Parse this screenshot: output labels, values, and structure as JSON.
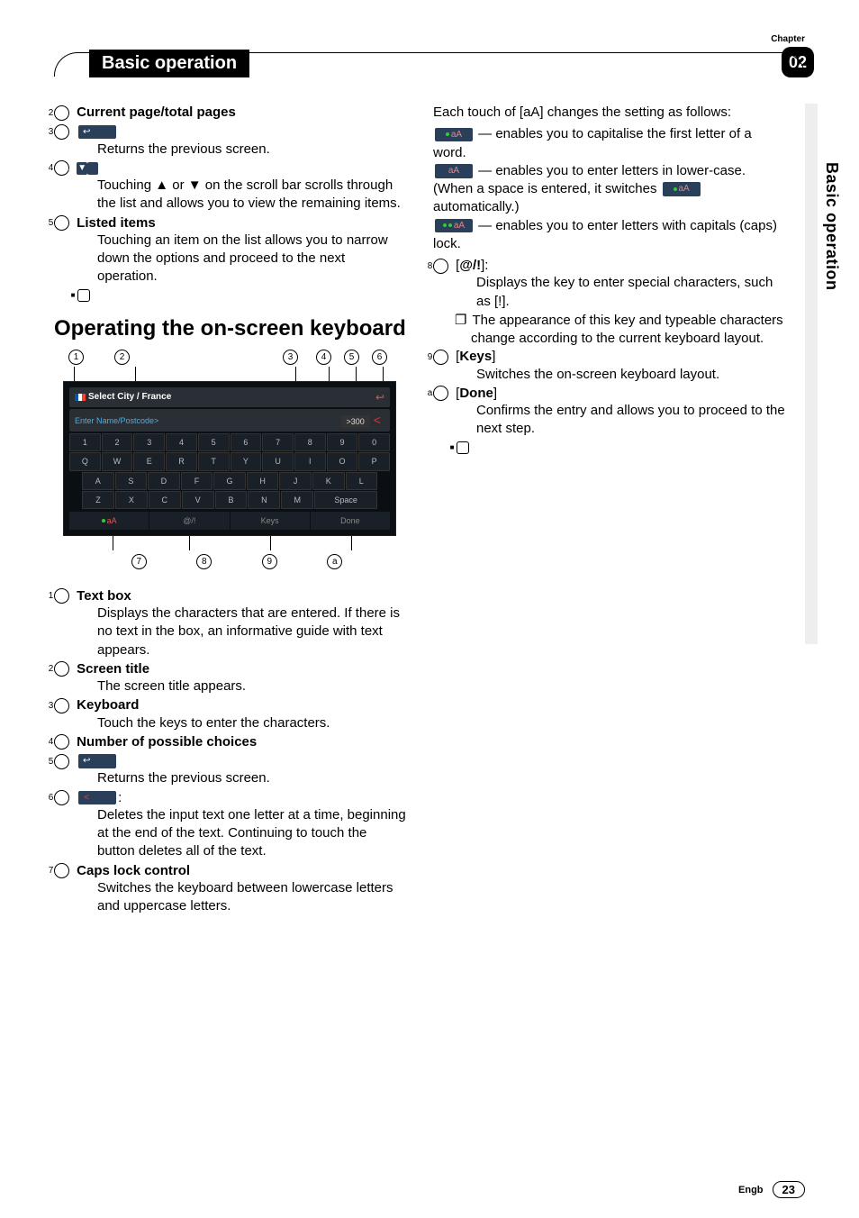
{
  "header": {
    "chapter_label": "Chapter",
    "chapter_number": "02",
    "title": "Basic operation",
    "side_tab": "Basic operation"
  },
  "col1": {
    "items": [
      {
        "num": "2",
        "title": "Current page/total pages",
        "body": ""
      },
      {
        "num": "3",
        "title": "",
        "icon": "back",
        "body": "Returns the previous screen."
      },
      {
        "num": "4",
        "title": "",
        "icon": "scroll",
        "body": "Touching ▲ or ▼ on the scroll bar scrolls through the list and allows you to view the remaining items."
      },
      {
        "num": "5",
        "title": "Listed items",
        "body": "Touching an item on the list allows you to narrow down the options and proceed to the next operation."
      }
    ],
    "section_title": "Operating the on-screen keyboard",
    "keyboard": {
      "top_callouts": [
        "1",
        "2",
        "3",
        "4",
        "5",
        "6"
      ],
      "screen_title": "Select City / France",
      "placeholder": "Enter Name/Postcode>",
      "count": ">300",
      "row1": [
        "1",
        "2",
        "3",
        "4",
        "5",
        "6",
        "7",
        "8",
        "9",
        "0"
      ],
      "row2": [
        "Q",
        "W",
        "E",
        "R",
        "T",
        "Y",
        "U",
        "I",
        "O",
        "P"
      ],
      "row3": [
        "A",
        "S",
        "D",
        "F",
        "G",
        "H",
        "J",
        "K",
        "L"
      ],
      "row4": [
        "Z",
        "X",
        "C",
        "V",
        "B",
        "N",
        "M",
        "Space"
      ],
      "bottom": [
        "aA",
        "@/!",
        "Keys",
        "Done"
      ],
      "bottom_callouts": [
        "7",
        "8",
        "9",
        "a"
      ]
    },
    "items2": [
      {
        "num": "1",
        "title": "Text box",
        "body": "Displays the characters that are entered. If there is no text in the box, an informative guide with text appears."
      },
      {
        "num": "2",
        "title": "Screen title",
        "body": "The screen title appears."
      },
      {
        "num": "3",
        "title": "Keyboard",
        "body": "Touch the keys to enter the characters."
      },
      {
        "num": "4",
        "title": "Number of possible choices",
        "body": ""
      },
      {
        "num": "5",
        "title": "",
        "icon": "back",
        "body": "Returns the previous screen."
      },
      {
        "num": "6",
        "title": "",
        "icon": "lt",
        "suffix": ":",
        "body": "Deletes the input text one letter at a time, beginning at the end of the text. Continuing to touch the button deletes all of the text."
      },
      {
        "num": "7",
        "title": "Caps lock control",
        "body": "Switches the keyboard between lowercase letters and uppercase letters."
      }
    ]
  },
  "col2": {
    "intro": "Each touch of [aA] changes the setting as follows:",
    "modes": [
      {
        "label": "aA",
        "dots": 1,
        "body": " — enables you to capitalise the first letter of a word."
      },
      {
        "label": "aA",
        "dots": 0,
        "body": " — enables you to enter letters in lower-case. (When a space is entered, it switches ",
        "tail": " automatically.)",
        "tail_label": "aA",
        "tail_dots": 1
      },
      {
        "label": "aA",
        "dots": 2,
        "body": " — enables you to enter letters with capitals (caps) lock."
      }
    ],
    "items": [
      {
        "num": "8",
        "title_prefix": "[",
        "title": "@/!",
        "title_suffix": "]:",
        "body": "Displays the key to enter special characters, such as [!].",
        "sub": "The appearance of this key and typeable characters change according to the current keyboard layout."
      },
      {
        "num": "9",
        "title_prefix": "[",
        "title": "Keys",
        "title_suffix": "]",
        "body": "Switches the on-screen keyboard layout."
      },
      {
        "num": "a",
        "title_prefix": "[",
        "title": "Done",
        "title_suffix": "]",
        "body": "Confirms the entry and allows you to proceed to the next step."
      }
    ]
  },
  "footer": {
    "lang": "Engb",
    "page": "23"
  }
}
